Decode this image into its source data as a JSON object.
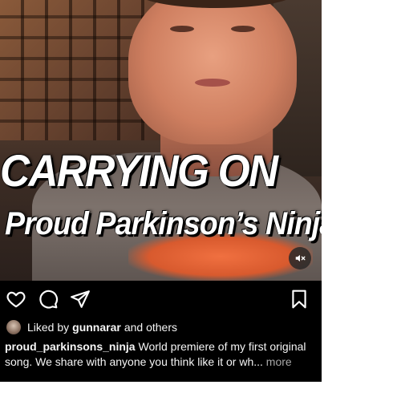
{
  "video": {
    "overlay_line1": "CARRYING ON",
    "overlay_line2": "Proud Parkinson’s Ninja",
    "mute_icon": "speaker-muted-icon"
  },
  "actions": {
    "like_icon": "heart-icon",
    "comment_icon": "comment-bubble-icon",
    "share_icon": "paper-plane-icon",
    "save_icon": "bookmark-icon"
  },
  "likes": {
    "prefix": "Liked by",
    "user": "gunnarar",
    "suffix": "and others"
  },
  "caption": {
    "username": "proud_parkinsons_ninja",
    "text": "World premiere of my first original song. We share with anyone you think like it or wh...",
    "more": "more"
  },
  "colors": {
    "background": "#000000",
    "text": "#f5f5f5",
    "muted": "#a8a8a8"
  }
}
